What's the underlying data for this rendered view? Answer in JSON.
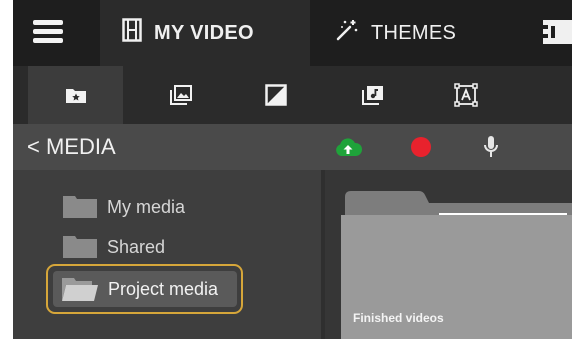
{
  "header": {
    "menu_icon": "hamburger-menu-icon",
    "tabs": [
      {
        "label": "MY VIDEO",
        "icon": "film-strip-icon",
        "active": true
      },
      {
        "label": "THEMES",
        "icon": "magic-wand-icon",
        "active": false
      }
    ]
  },
  "toolbar": {
    "buttons": [
      {
        "icon": "media-folder-icon",
        "active": true
      },
      {
        "icon": "photo-library-icon",
        "active": false
      },
      {
        "icon": "contrast-filter-icon",
        "active": false
      },
      {
        "icon": "music-note-icon",
        "active": false
      },
      {
        "icon": "text-box-icon",
        "active": false
      }
    ]
  },
  "media_bar": {
    "back_label": "< MEDIA",
    "actions": [
      {
        "icon": "cloud-upload-icon",
        "color": "#1fa33a"
      },
      {
        "icon": "record-icon",
        "color": "#e8222d"
      },
      {
        "icon": "microphone-icon",
        "color": "#e6e6e6"
      }
    ]
  },
  "folders": [
    {
      "label": "My media",
      "selected": false
    },
    {
      "label": "Shared",
      "selected": false
    },
    {
      "label": "Project media",
      "selected": true
    }
  ],
  "content": {
    "folder_label": "Finished videos"
  },
  "colors": {
    "header_bg": "#1e1e1e",
    "selection_outline": "#d6a63a",
    "upload_green": "#1fa33a",
    "record_red": "#e8222d"
  }
}
